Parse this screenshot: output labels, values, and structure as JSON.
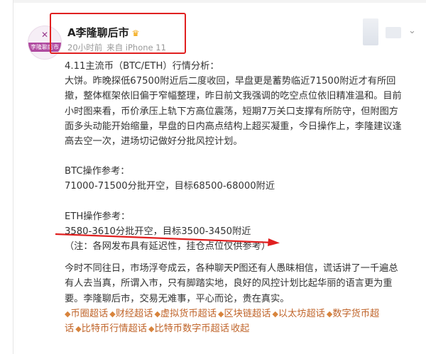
{
  "post": {
    "author": "A李隆聊后市",
    "avatar_text": "李隆聊后市",
    "time": "20小时前",
    "source": "来自 iPhone 11",
    "lines": {
      "l0": "4.11主流币（BTC/ETH）行情分析：",
      "l1": "大饼。昨晚探低67500附近后二度收回，早盘更是蓄势临近71500附近才有所回",
      "l2": "撤，整体框架依旧偏于窄幅整理，昨日前文我强调的吃空点位依旧精准温和。目前",
      "l3": "小时图来看，币价承压上轨下方高位震荡，短期7万关口支撑有所防守，但附图方",
      "l4": "面多头动能开始缩量，早盘的日内高点结构上超买凝重，今日操作上，李隆建议逢",
      "l5": "高去空一次，进场切记做好分批风控计划。",
      "btc_title": "BTC操作参考：",
      "btc_plan": "71000-71500分批开空，目标68500-68000附近",
      "eth_title": "ETH操作参考：",
      "eth_plan": "3580-3610分批开空，目标3500-3450附近",
      "note": "（注：各网发布具有延迟性，挂仓点位仅供参考）",
      "p1": "今时不同往日，市场浮夸成云，各种聊天P图还有人愚昧相信，谎话讲了一千遍总",
      "p2": "有人去当真，所谓入市，只有脚踏实地，良好的风控计划比起华丽的语言更为重",
      "p3": "要。李隆聊后市，交易无难事，平心而论，贵在真实。"
    },
    "topics": {
      "t1": "币圈超话",
      "t2": "财经超话",
      "t3": "虚拟货币超话",
      "t4": "区块链超话",
      "t5": "以太坊超话",
      "t6": "数字货币超",
      "t6b": "话",
      "t7": "比特币行情超话",
      "t8": "比特币数字币超话",
      "fold": "收起"
    }
  },
  "colors": {
    "topic": "#c0652b",
    "highlight_box": "#e02020",
    "underline": "#e02020"
  },
  "icons": [
    "vip-crown-icon",
    "chevron-down-icon",
    "diamond-icon"
  ]
}
